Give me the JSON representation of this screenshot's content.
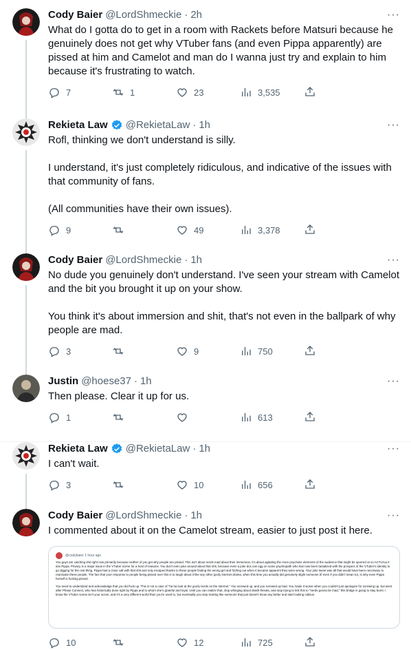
{
  "tweets": [
    {
      "name": "Cody Baier",
      "handle": "@LordShmeckie",
      "time": "2h",
      "verified": false,
      "text": "What do I gotta do to get in a room with Rackets before Matsuri because he genuinely does not get why VTuber fans (and even Pippa apparently) are pissed at him and Camelot and man do I wanna just try and explain to him because it's frustrating to watch.",
      "replies": "7",
      "retweets": "1",
      "likes": "23",
      "views": "3,535"
    },
    {
      "name": "Rekieta Law",
      "handle": "@RekietaLaw",
      "time": "1h",
      "verified": true,
      "text": "Rofl, thinking we don't understand is silly.\n\nI understand, it's just completely ridiculous, and indicative of the issues with that community of fans.\n\n(All communities have their own issues).",
      "replies": "9",
      "retweets": "",
      "likes": "49",
      "views": "3,378"
    },
    {
      "name": "Cody Baier",
      "handle": "@LordShmeckie",
      "time": "1h",
      "verified": false,
      "text": "No dude you genuinely don't understand. I've seen your stream with Camelot and the bit you brought it up on your show.\n\nYou think it's about immersion and shit, that's not even in the ballpark of why people are mad.",
      "replies": "3",
      "retweets": "",
      "likes": "9",
      "views": "750"
    },
    {
      "name": "Justin",
      "handle": "@hoese37",
      "time": "1h",
      "verified": false,
      "text": "Then please. Clear it up for us.",
      "replies": "1",
      "retweets": "",
      "likes": "",
      "views": "613"
    },
    {
      "name": "Rekieta Law",
      "handle": "@RekietaLaw",
      "time": "1h",
      "verified": true,
      "text": "I can't wait.",
      "replies": "3",
      "retweets": "",
      "likes": "10",
      "views": "656"
    },
    {
      "name": "Cody Baier",
      "handle": "@LordShmeckie",
      "time": "1h",
      "verified": false,
      "text": "I commented about it on the Camelot stream, easier to just post it here.",
      "replies": "10",
      "retweets": "",
      "likes": "12",
      "views": "725"
    }
  ],
  "embed": {
    "user": "@codybaier",
    "time": "1 hour ago",
    "para1": "You guys are catching shit right now primarily because neither of you get why people are pissed. This isn't about nerds mad about their immersion, it's about agitating the more psychotic elements of the audience that might be spurred on to ACTUALLY dox Pippa. Privacy is a major issue in the VTuber scene for a host of reasons. You don't even joke around about that shit, because even a joke dox can egg on some psychopath who has now been tantalized with the prospect of the VTuber's identity to go digging for the real thing. Pippa had a close call with that shit and only escaped thanks to these people finding the wrong girl and fizzling out when it became apparent they were wrong. Your joke tweet was all that would have been necessary to reactivate these people. The fact that your response to people being pissed over this is to laugh about it like any other goofy internet drama, when this time you actually did genuinely slight someone (if even if you didn't mean to), is why even Pippa herself is fucking pissed.",
    "para2": "You need to understand and acknowledge that you did fuck up. This is not a case of \"ha ha look at the goofy nerds on the internet.\" You screwed up, and you screwed up bad. You made it worse when you couldn't just apologize for screwing up, but went after Phase Connect, who has historically done right by Pippa and to whom she's grateful and loyal. Until you can realize that, stop whinging about death threats, and stop trying to link this to \"nerds gonna be mad,\" this bridge is going to stay burnt. I know the VTuber scene isn't your scene, and it's a very different world than you're used to, but eventually you stop looking like someone that just doesn't know any better and start looking callous."
  },
  "colors": {
    "accent": "#1d9bf0",
    "muted": "#536471",
    "divider": "#eff3f4"
  }
}
